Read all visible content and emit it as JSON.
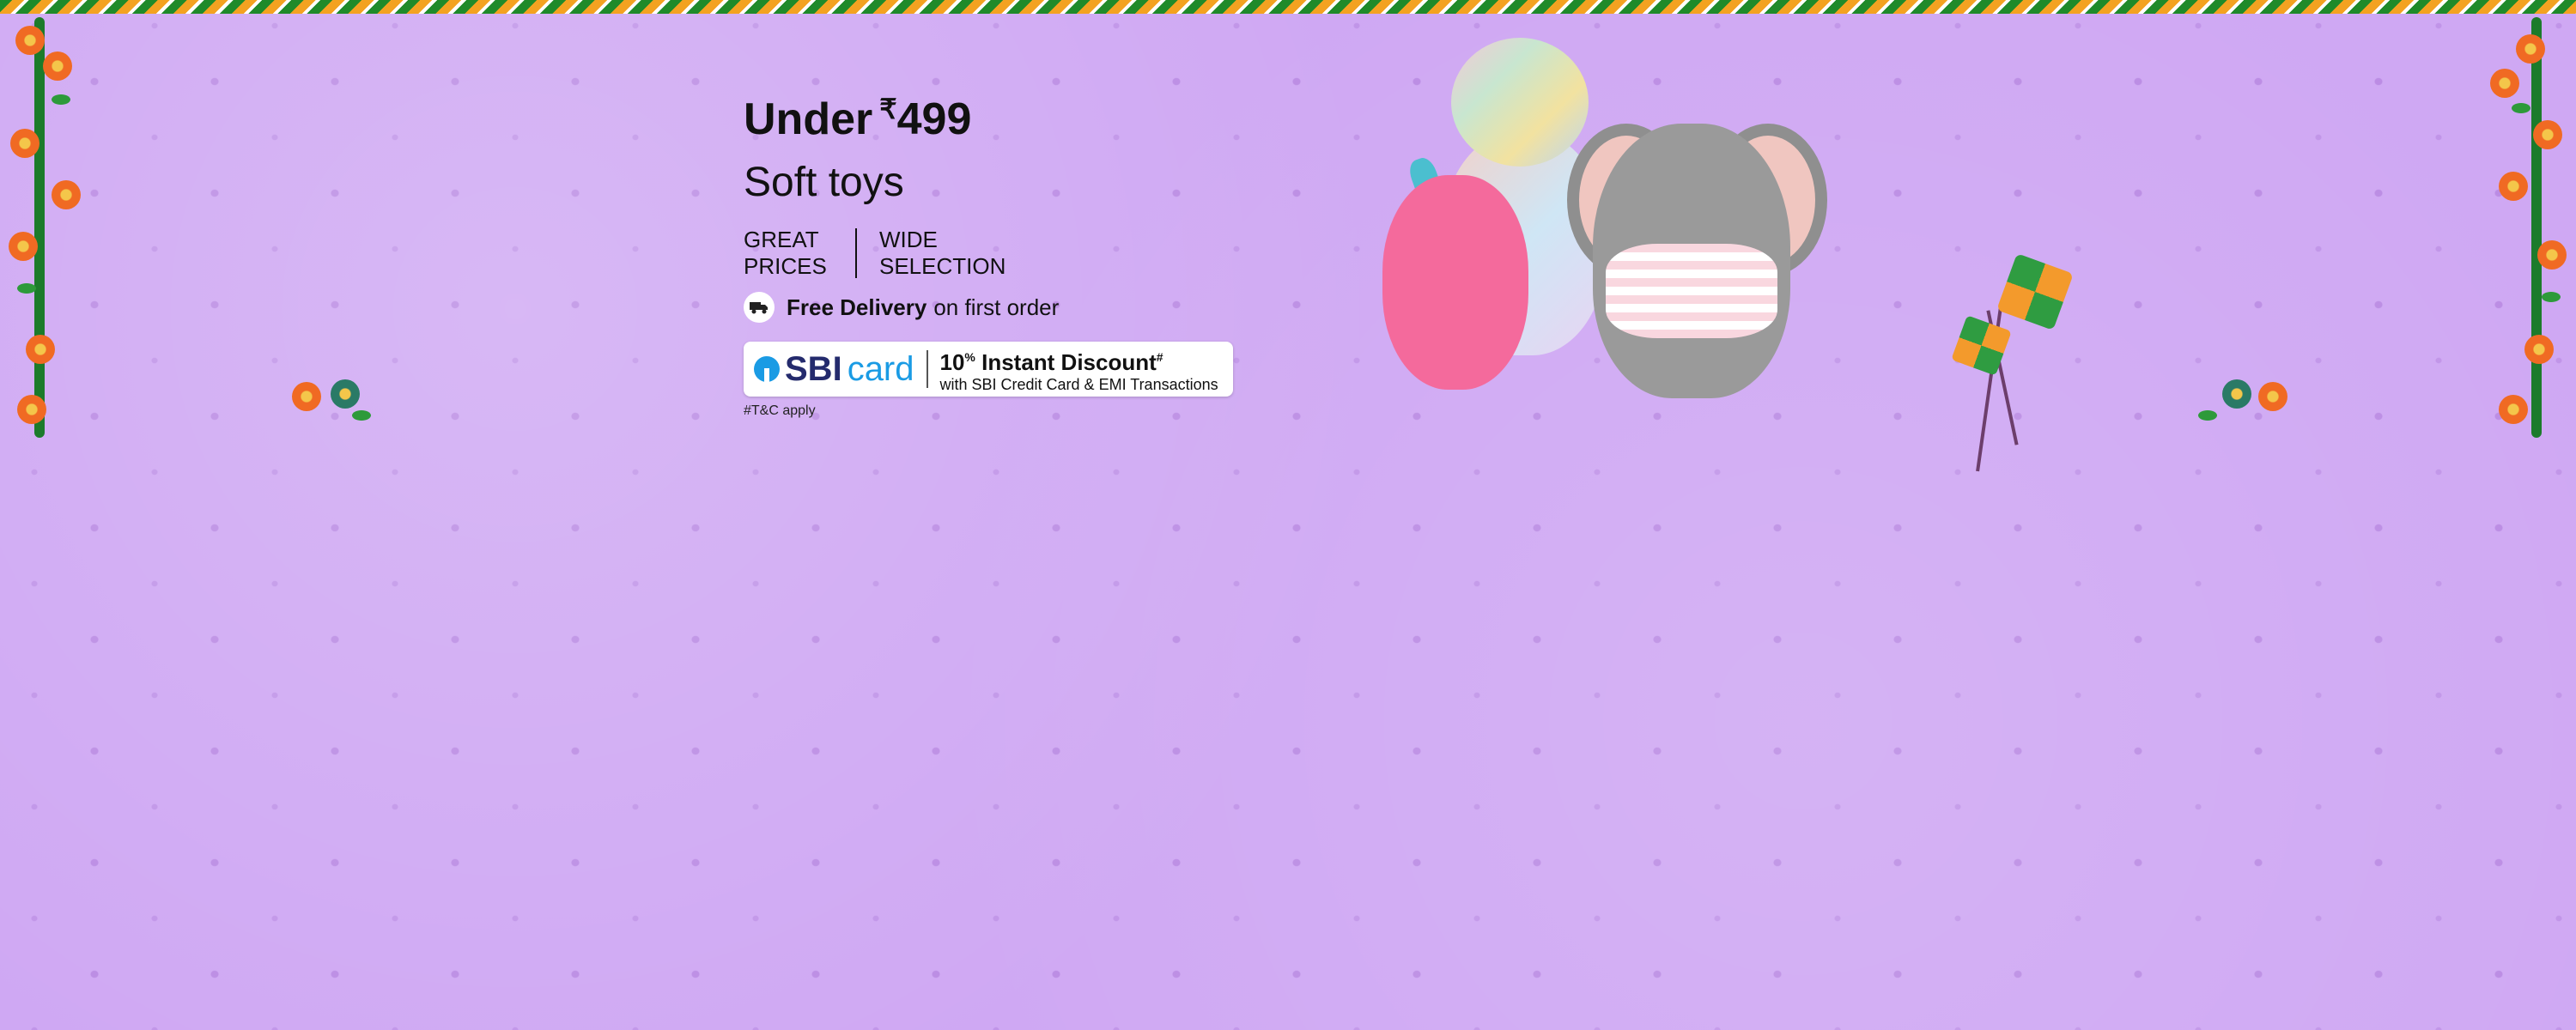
{
  "banner": {
    "headline": "Under",
    "currency": "₹",
    "price": "499",
    "category": "Soft toys",
    "features": [
      "GREAT PRICES",
      "WIDE SELECTION"
    ],
    "delivery": {
      "icon": "truck-icon",
      "bold": "Free Delivery",
      "rest": "on first order"
    },
    "offer": {
      "brand_sbi": "SBI",
      "brand_card": "card",
      "percent": "10",
      "percent_sign": "%",
      "title": "Instant Discount",
      "title_sup": "#",
      "subtitle": "with SBI Credit Card & EMI Transactions"
    },
    "tnc": "#T&C apply"
  },
  "colors": {
    "background": "#cfa8f3",
    "text": "#111111",
    "sbi_blue": "#1a9be4",
    "sbi_navy": "#242b6d"
  }
}
